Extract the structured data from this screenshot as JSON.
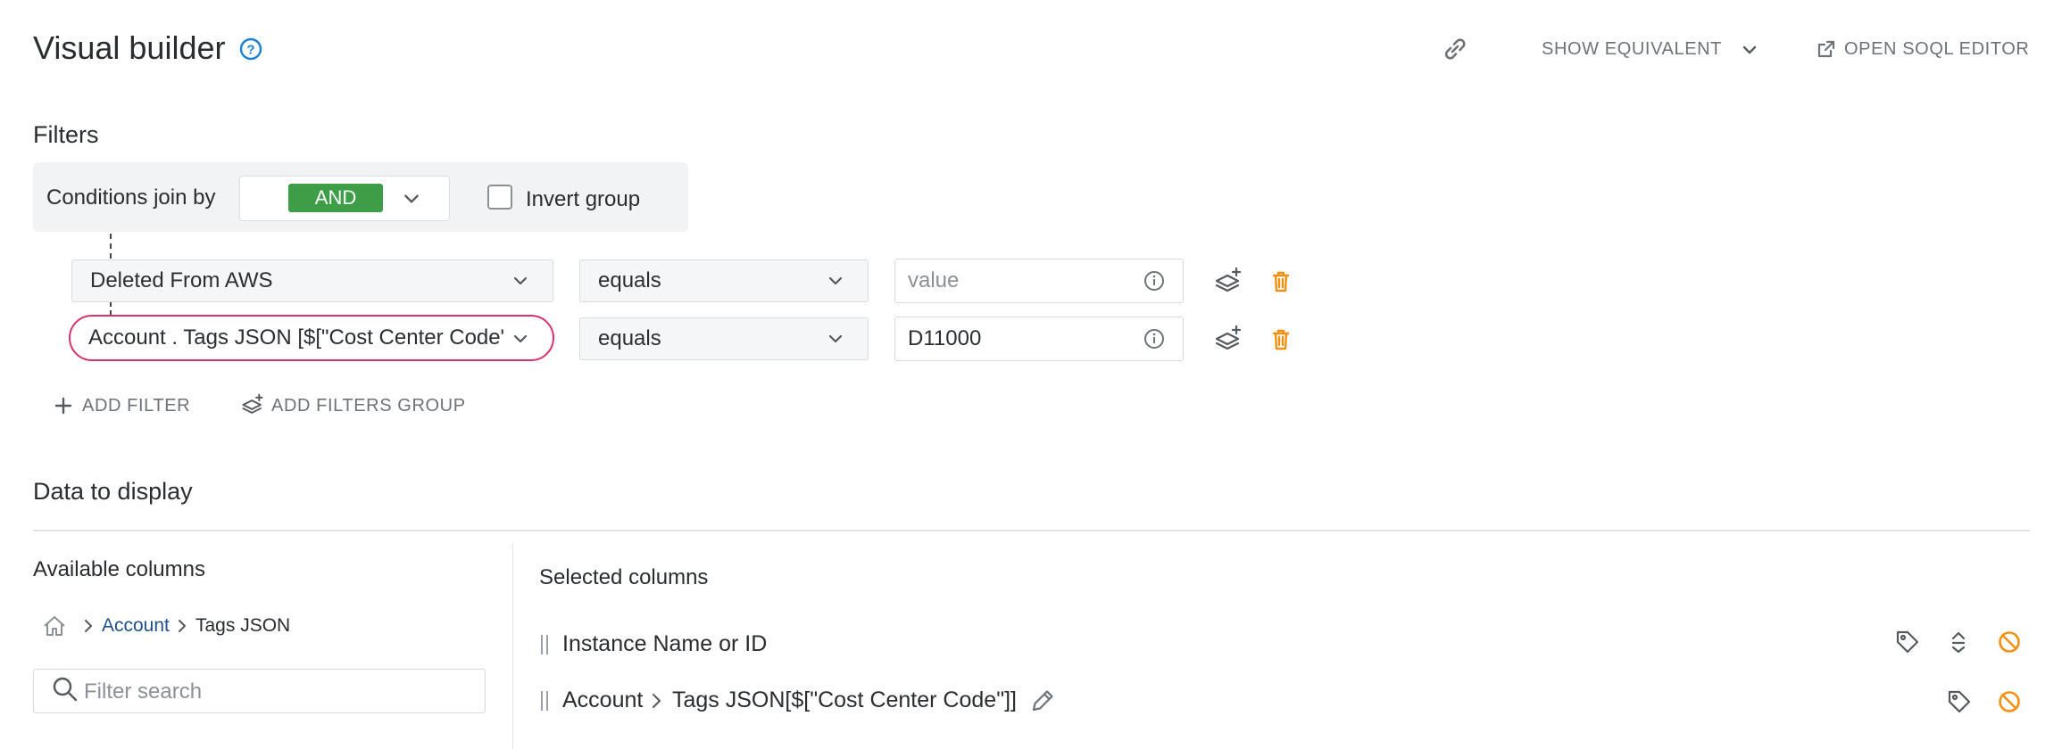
{
  "header": {
    "title": "Visual builder",
    "show_equivalent_label": "SHOW EQUIVALENT",
    "open_soql_label": "OPEN SOQL EDITOR"
  },
  "filters": {
    "section_title": "Filters",
    "conditions_join_label": "Conditions join by",
    "join_value": "AND",
    "invert_group_label": "Invert group",
    "invert_group_checked": false,
    "rows": [
      {
        "field": "Deleted From AWS",
        "operator": "equals",
        "value": "",
        "placeholder": "value"
      },
      {
        "field": "Account . Tags JSON [$[\"Cost Center Code\"]]",
        "operator": "equals",
        "value": "D11000",
        "placeholder": "value"
      }
    ],
    "add_filter_label": "ADD FILTER",
    "add_filters_group_label": "ADD FILTERS GROUP"
  },
  "data_display": {
    "section_title": "Data to display",
    "available_columns_label": "Available columns",
    "breadcrumb": {
      "level1": "Account",
      "level2": "Tags JSON"
    },
    "search_placeholder": "Filter search",
    "selected_columns_label": "Selected columns",
    "selected_columns": [
      {
        "label": "Instance Name or ID"
      },
      {
        "parent": "Account",
        "label": "Tags JSON[$[\"Cost Center Code\"]]"
      }
    ]
  },
  "colors": {
    "and_green": "#3d9e47",
    "focus_pink": "#d9336b",
    "delete_orange": "#f29111",
    "help_blue": "#1c7fd6",
    "link_blue": "#1f4f8f"
  }
}
